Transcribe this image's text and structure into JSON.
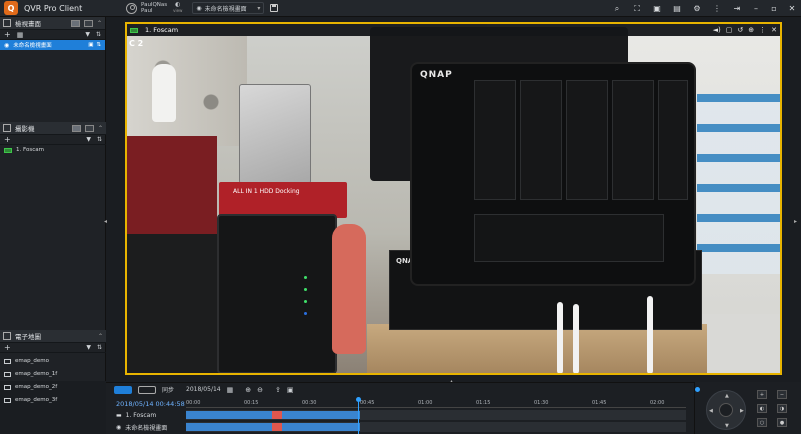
{
  "app": {
    "title": "QVR Pro Client",
    "logo": "Q"
  },
  "user": {
    "name": "PaulQNas",
    "sub": "Paul"
  },
  "mode": {
    "glyph": "◐",
    "label": "view"
  },
  "view_select": {
    "value": "未命名檢視畫面"
  },
  "toolbar_icons": [
    "search-icon",
    "fullscreen-icon",
    "lock-icon",
    "lock-icon",
    "gear-icon",
    "more-icon",
    "logout-icon"
  ],
  "sidebar": {
    "views_panel": {
      "title": "檢視畫面",
      "items": [
        {
          "label": "未命名檢視畫面"
        }
      ]
    },
    "cameras_panel": {
      "title": "攝影機",
      "items": [
        {
          "label": "1. Foscam"
        }
      ]
    },
    "emap_panel": {
      "title": "電子地圖",
      "items": [
        {
          "label": "emap_demo"
        },
        {
          "label": "emap_demo_1f"
        },
        {
          "label": "emap_demo_2f"
        },
        {
          "label": "emap_demo_3f"
        }
      ]
    }
  },
  "video": {
    "title": "1. Foscam",
    "channel": "C 2",
    "dock_text": "ALL IN 1 HDD Docking",
    "brand_main": "QNAP",
    "brand_switch": "QNAP"
  },
  "timeline": {
    "sync_label": "同步",
    "date": "2018/05/14",
    "datetime": "2018/05/14 00:44:58",
    "ticks": [
      "00:00",
      "00:15",
      "00:30",
      "00:45",
      "01:00",
      "01:15",
      "01:30",
      "01:45",
      "02:00"
    ],
    "rows": [
      {
        "label": "1. Foscam"
      },
      {
        "label": "未命名檢視畫面"
      }
    ]
  },
  "colors": {
    "accent": "#1f7fd9",
    "selected_border": "#e8b400",
    "recording": "#3a84cf",
    "alert": "#e0574e"
  }
}
